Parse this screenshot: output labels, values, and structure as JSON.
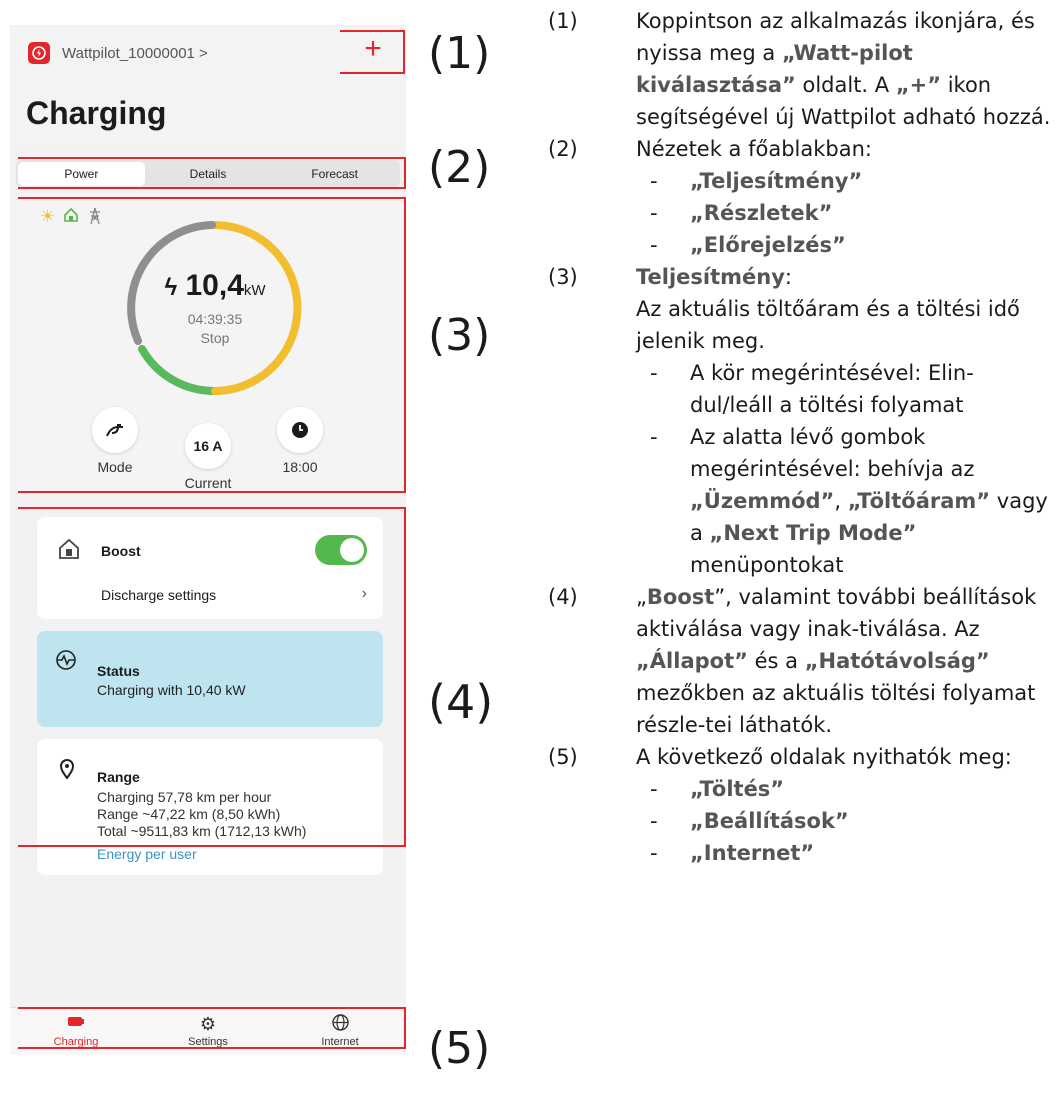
{
  "app": {
    "device_name": "Wattpilot_10000001 >",
    "add_label": "+",
    "page_title": "Charging"
  },
  "tabs": [
    "Power",
    "Details",
    "Forecast"
  ],
  "power": {
    "value": "10,4",
    "unit": "kW",
    "timer": "04:39:35",
    "action": "Stop",
    "controls": {
      "mode_label": "Mode",
      "current_value": "16 A",
      "current_label": "Current",
      "time_label": "18:00"
    }
  },
  "boost": {
    "label": "Boost",
    "toggle_on": true,
    "discharge_label": "Discharge settings"
  },
  "status": {
    "title": "Status",
    "text": "Charging with 10,40 kW"
  },
  "range": {
    "title": "Range",
    "lines": [
      "Charging 57,78 km per hour",
      "Range ~47,22 km (8,50 kWh)",
      "Total ~9511,83 km (1712,13 kWh)"
    ],
    "link": "Energy per user"
  },
  "nav": [
    "Charging",
    "Settings",
    "Internet"
  ],
  "markers": [
    "(1)",
    "(2)",
    "(3)",
    "(4)",
    "(5)"
  ],
  "explanation": {
    "i1": {
      "num": "(1)",
      "a": "Koppintson az alkalmazás ikonjára, és nyissa meg a ",
      "b": "„Watt-pilot kiválasztása”",
      "c": " oldalt. A ",
      "d": "„+”",
      "e": " ikon segítségével új Wattpilot adható hozzá."
    },
    "i2": {
      "num": "(2)",
      "text": "Nézetek a főablakban:",
      "subs": [
        "„Teljesítmény”",
        "„Részletek”",
        "„Előrejelzés”"
      ]
    },
    "i3": {
      "num": "(3)",
      "title": "Teljesítmény",
      "colon": ":",
      "text": "Az aktuális töltőáram és a töltési idő jelenik meg.",
      "sub1": "A kör megérintésével: Elin-dul/leáll a töltési folyamat",
      "sub2a": "Az alatta lévő gombok megérintésével: behívja az ",
      "sub2b": "„Üzemmód”",
      "sub2c": ", ",
      "sub2d": "„Töltőáram”",
      "sub2e": " vagy a ",
      "sub2f": "„Next Trip Mode”",
      "sub2g": " menüpontokat"
    },
    "i4": {
      "num": "(4)",
      "a": "„",
      "b": "Boost",
      "c": "”, valamint további beállítások aktiválása vagy inak-tiválása. Az ",
      "d": "„Állapot”",
      "e": " és a ",
      "f": "„Hatótávolság”",
      "g": " mezőkben az aktuális töltési folyamat részle-tei láthatók."
    },
    "i5": {
      "num": "(5)",
      "text": "A következő oldalak nyithatók meg:",
      "subs": [
        "„Töltés”",
        "„Beállítások”",
        "„Internet”"
      ]
    }
  },
  "colors": {
    "accent": "#e2262c",
    "ring_yellow": "#f2bd2e",
    "ring_green": "#5cb85c",
    "ring_gray": "#8f8f8f",
    "status_bg": "#bde4ef",
    "toggle": "#53b94e"
  }
}
